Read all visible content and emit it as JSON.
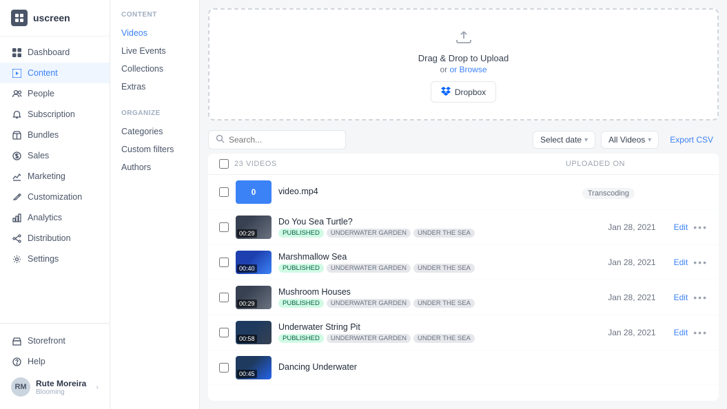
{
  "logo": {
    "text": "uscreen"
  },
  "sidebar": {
    "items": [
      {
        "id": "dashboard",
        "label": "Dashboard",
        "icon": "grid"
      },
      {
        "id": "content",
        "label": "Content",
        "icon": "play",
        "active": true
      },
      {
        "id": "people",
        "label": "People",
        "icon": "users"
      },
      {
        "id": "subscription",
        "label": "Subscription",
        "icon": "bell"
      },
      {
        "id": "bundles",
        "label": "Bundles",
        "icon": "package"
      },
      {
        "id": "sales",
        "label": "Sales",
        "icon": "dollar"
      },
      {
        "id": "marketing",
        "label": "Marketing",
        "icon": "chart"
      },
      {
        "id": "customization",
        "label": "Customization",
        "icon": "edit"
      },
      {
        "id": "analytics",
        "label": "Analytics",
        "icon": "bar-chart"
      },
      {
        "id": "distribution",
        "label": "Distribution",
        "icon": "share"
      },
      {
        "id": "settings",
        "label": "Settings",
        "icon": "gear"
      }
    ],
    "bottom": [
      {
        "id": "storefront",
        "label": "Storefront",
        "icon": "store"
      },
      {
        "id": "help",
        "label": "Help",
        "icon": "circle"
      }
    ],
    "user": {
      "name": "Rute Moreira",
      "company": "Blooming",
      "initials": "RM"
    }
  },
  "content_menu": {
    "section1": {
      "label": "CONTENT",
      "items": [
        {
          "id": "videos",
          "label": "Videos",
          "active": true
        },
        {
          "id": "live-events",
          "label": "Live Events"
        },
        {
          "id": "collections",
          "label": "Collections"
        },
        {
          "id": "extras",
          "label": "Extras"
        }
      ]
    },
    "section2": {
      "label": "ORGANIZE",
      "items": [
        {
          "id": "categories",
          "label": "Categories"
        },
        {
          "id": "custom-filters",
          "label": "Custom filters"
        },
        {
          "id": "authors",
          "label": "Authors"
        }
      ]
    }
  },
  "upload": {
    "title": "Drag & Drop to Upload",
    "browse_text": "or Browse",
    "dropbox_label": "Dropbox"
  },
  "toolbar": {
    "search_placeholder": "Search...",
    "select_date": "Select date",
    "all_videos": "All Videos",
    "export_csv": "Export CSV"
  },
  "videos_list": {
    "count_label": "23 VIDEOS",
    "uploaded_on_label": "UPLOADED ON",
    "rows": [
      {
        "id": "transcoding",
        "title": "video.mp4",
        "status": "Transcoding",
        "thumb_color": "blue",
        "thumb_text": "0",
        "date": "",
        "tags": []
      },
      {
        "id": "sea-turtle",
        "title": "Do You Sea Turtle?",
        "status": "published",
        "thumb_class": "thumb-sea",
        "duration": "00:29",
        "date": "Jan 28, 2021",
        "tags": [
          "PUBLISHED",
          "UNDERWATER GARDEN",
          "UNDER THE SEA"
        ]
      },
      {
        "id": "marshmallow",
        "title": "Marshmallow Sea",
        "status": "published",
        "thumb_class": "thumb-marshmallow",
        "duration": "00:40",
        "date": "Jan 28, 2021",
        "tags": [
          "PUBLISHED",
          "UNDERWATER GARDEN",
          "UNDER THE SEA"
        ]
      },
      {
        "id": "mushroom",
        "title": "Mushroom Houses",
        "status": "published",
        "thumb_class": "thumb-mushroom",
        "duration": "00:29",
        "date": "Jan 28, 2021",
        "tags": [
          "PUBLISHED",
          "UNDERWATER GARDEN",
          "UNDER THE SEA"
        ]
      },
      {
        "id": "string-pit",
        "title": "Underwater String Pit",
        "status": "published",
        "thumb_class": "thumb-string",
        "duration": "00:58",
        "date": "Jan 28, 2021",
        "tags": [
          "PUBLISHED",
          "UNDERWATER GARDEN",
          "UNDER THE SEA"
        ]
      },
      {
        "id": "dancing",
        "title": "Dancing Underwater",
        "status": "published",
        "thumb_class": "thumb-dancing",
        "duration": "00:45",
        "date": "",
        "tags": []
      }
    ]
  }
}
